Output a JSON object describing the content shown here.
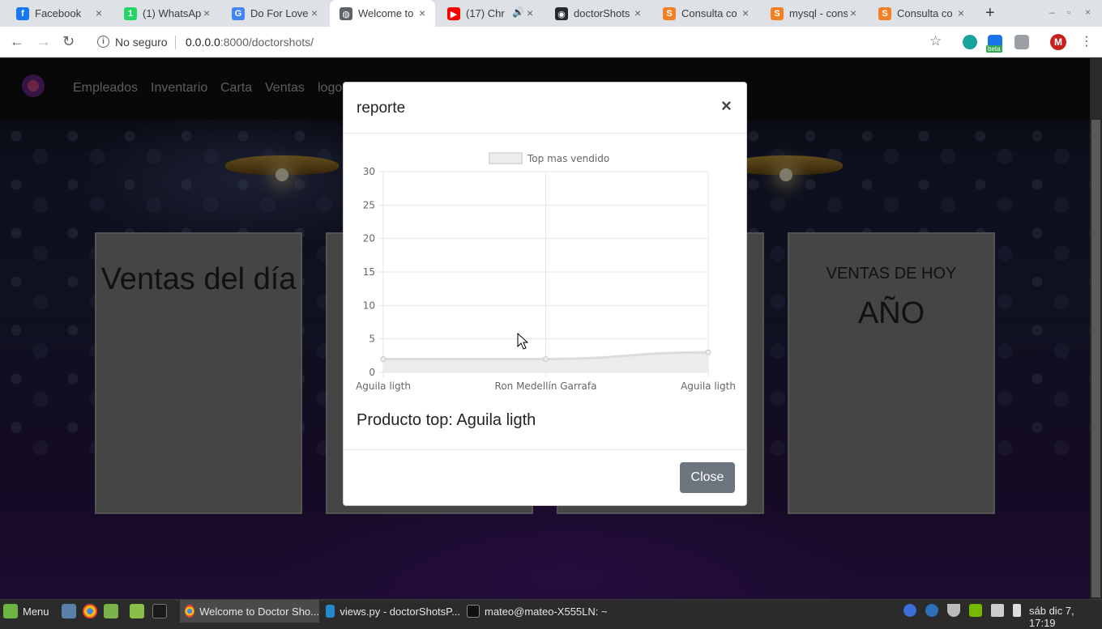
{
  "browser": {
    "tabs": [
      {
        "title": "Facebook",
        "favicon": "facebook-icon",
        "color": "#1877f2",
        "glyph": "f"
      },
      {
        "title": "(1) WhatsAp",
        "favicon": "whatsapp-icon",
        "color": "#25d366",
        "glyph": "1"
      },
      {
        "title": "Do For Love",
        "favicon": "google-icon",
        "color": "#4285f4",
        "glyph": "G"
      },
      {
        "title": "Welcome to",
        "favicon": "globe-icon",
        "color": "#5f6368",
        "glyph": "◍"
      },
      {
        "title": "(17) Chr",
        "favicon": "youtube-icon",
        "color": "#ff0000",
        "glyph": "▶"
      },
      {
        "title": "doctorShots",
        "favicon": "github-icon",
        "color": "#24292e",
        "glyph": "◉"
      },
      {
        "title": "Consulta co",
        "favicon": "stackoverflow-icon",
        "color": "#f48024",
        "glyph": "S"
      },
      {
        "title": "mysql - cons",
        "favicon": "stackoverflow-icon",
        "color": "#f48024",
        "glyph": "S"
      },
      {
        "title": "Consulta co",
        "favicon": "stackoverflow-icon",
        "color": "#f48024",
        "glyph": "S"
      }
    ],
    "new_tab": "+",
    "security_label": "No seguro",
    "url_host": "0.0.0.0",
    "url_path": ":8000/doctorshots/",
    "extension_badge": "beta",
    "profile_initial": "M"
  },
  "site": {
    "nav": [
      "Empleados",
      "Inventario",
      "Carta",
      "Ventas",
      "logo"
    ],
    "cards": {
      "ventas_dia": "Ventas del día",
      "ventas_hoy": "VENTAS DE HOY",
      "anio": "AÑO"
    }
  },
  "modal": {
    "title": "reporte",
    "close_x": "×",
    "top_product": "Producto top: Aguila ligth",
    "close_button": "Close"
  },
  "chart_data": {
    "type": "line",
    "categories": [
      "Aguila ligth",
      "Ron Medellín Garrafa",
      "Aguila ligth"
    ],
    "series": [
      {
        "name": "Top mas vendido",
        "values": [
          2,
          2,
          3
        ]
      }
    ],
    "ylim": [
      0,
      30
    ],
    "yticks": [
      0,
      5,
      10,
      15,
      20,
      25,
      30
    ],
    "grid": true,
    "legend": "top",
    "fill": true,
    "colors": {
      "line": "#dcdcdc",
      "fill": "#ececec",
      "grid": "#e6e6e6"
    }
  },
  "taskbar": {
    "menu_label": "Menu",
    "windows": [
      "Welcome to Doctor Sho...",
      "views.py - doctorShotsP...",
      "mateo@mateo-X555LN: ~"
    ],
    "clock": "sáb dic  7, 17:19"
  }
}
